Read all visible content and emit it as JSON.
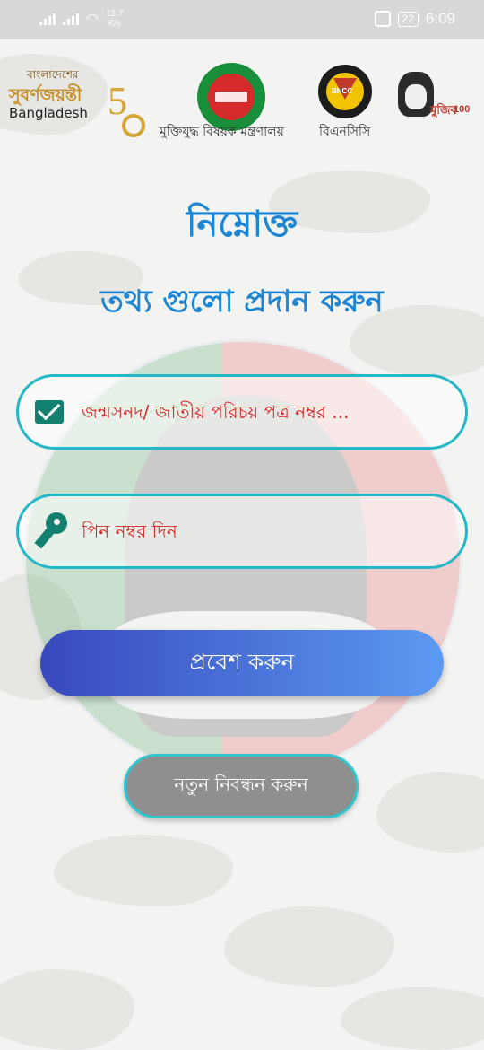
{
  "status_bar": {
    "speed_value": "12.7",
    "speed_unit": "K/s",
    "battery": "22",
    "time": "6:09"
  },
  "logos": {
    "golden_jubilee": {
      "line1": "বাংলাদেশের",
      "line2": "সুবর্ণজয়ন্তী",
      "line3": "Bangladesh",
      "number": "5"
    },
    "ministry_caption": "মুক্তিযুদ্ধ বিষয়ক মন্ত্রণালয়",
    "bncc_badge": "BNCC",
    "bncc_caption": "বিএনসিসি",
    "mujib": {
      "text": "মুজিব",
      "number": "100"
    }
  },
  "heading": {
    "line1": "নিম্নোক্ত",
    "line2": "তথ্য গুলো প্রদান করুন"
  },
  "form": {
    "id_field": {
      "placeholder": "জন্মসনদ/ জাতীয় পরিচয় পত্র নম্বর ...",
      "value": "",
      "icon": "mail-icon"
    },
    "pin_field": {
      "placeholder": "পিন নম্বর দিন",
      "value": "",
      "icon": "key-icon"
    },
    "login_button": "প্রবেশ করুন",
    "register_button": "নতুন নিবন্ধন করুন"
  },
  "colors": {
    "heading": "#1d86d4",
    "field_border": "#24b7c8",
    "placeholder": "#d72727",
    "icon": "#14806f",
    "login_gradient_start": "#3849bd",
    "login_gradient_end": "#5c9af2",
    "register_bg": "#8f8f8f"
  }
}
